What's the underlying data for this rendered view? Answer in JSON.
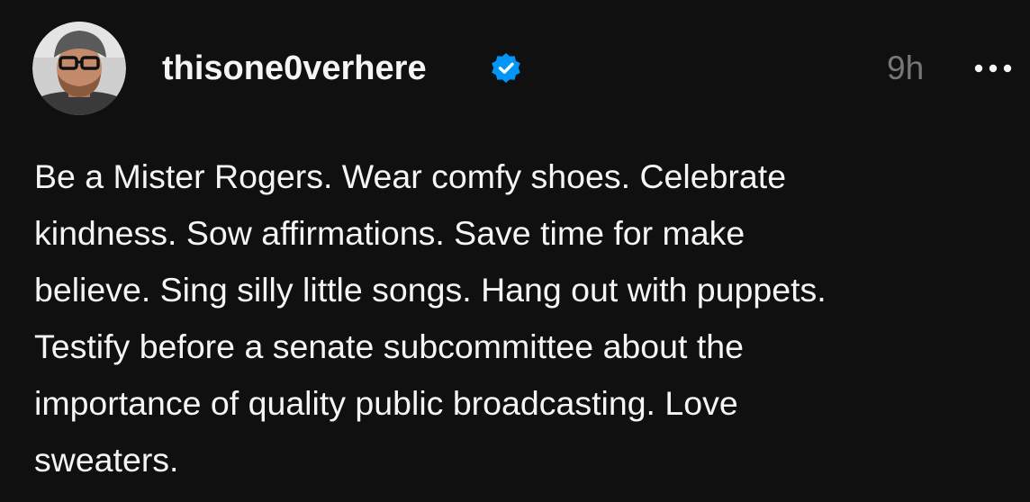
{
  "post": {
    "author": {
      "username": "thisone0verhere",
      "verified": true,
      "avatar_icon": "profile-photo-icon"
    },
    "timestamp": "9h",
    "more_icon": "more-options-icon",
    "text_lines": [
      "Be a Mister Rogers. Wear comfy shoes. Celebrate",
      "kindness. Sow affirmations. Save time for make",
      "believe. Sing silly little songs. Hang out with puppets.",
      "Testify before a senate subcommittee about the",
      "importance of quality public broadcasting. Love",
      "sweaters."
    ]
  },
  "colors": {
    "background": "#101010",
    "text": "#f3f5f7",
    "muted": "#777777",
    "verified_badge": "#0095f6"
  }
}
